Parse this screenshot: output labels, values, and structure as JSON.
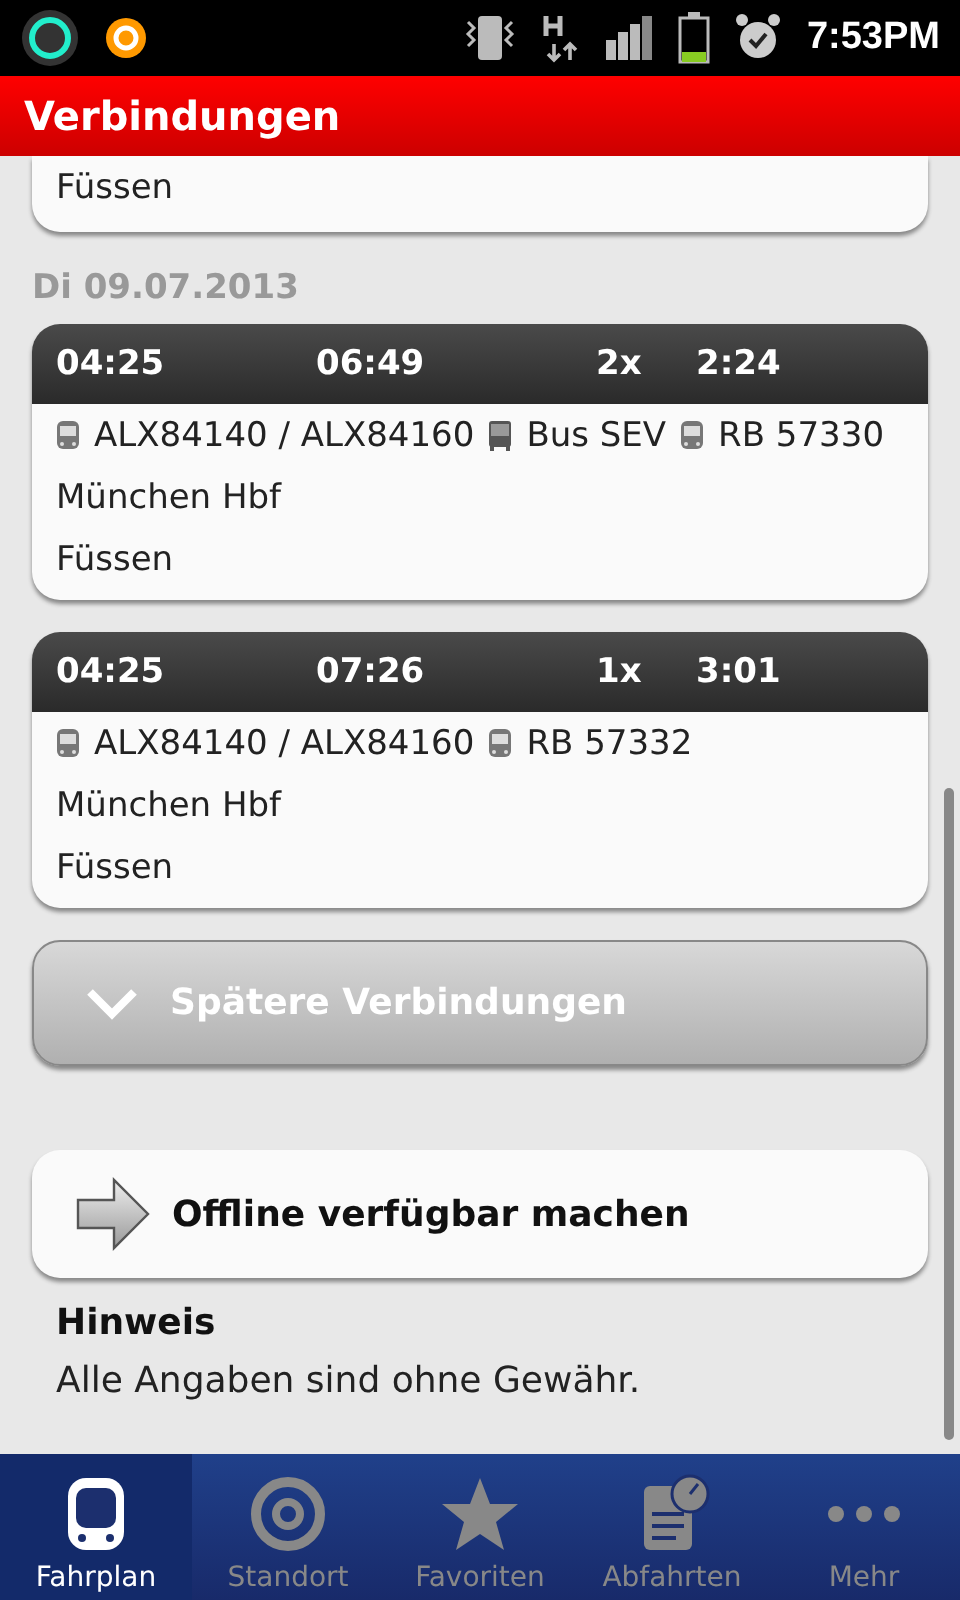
{
  "status_bar": {
    "time": "7:53PM"
  },
  "title": "Verbindungen",
  "partial_card": {
    "destination": "Füssen"
  },
  "date": "Di 09.07.2013",
  "connections": [
    {
      "departure": "04:25",
      "arrival": "06:49",
      "changes": "2x",
      "duration": "2:24",
      "legs": [
        {
          "kind": "train",
          "name": "ALX84140 / ALX84160"
        },
        {
          "kind": "bus",
          "name": "Bus SEV"
        },
        {
          "kind": "train",
          "name": "RB 57330"
        }
      ],
      "origin": "München Hbf",
      "destination": "Füssen"
    },
    {
      "departure": "04:25",
      "arrival": "07:26",
      "changes": "1x",
      "duration": "3:01",
      "legs": [
        {
          "kind": "train",
          "name": "ALX84140 / ALX84160"
        },
        {
          "kind": "train",
          "name": "RB 57332"
        }
      ],
      "origin": "München Hbf",
      "destination": "Füssen"
    }
  ],
  "later_button": "Spätere Verbindungen",
  "offline_button": "Offline verfügbar machen",
  "notice": {
    "heading": "Hinweis",
    "text": "Alle Angaben sind ohne Gewähr."
  },
  "nav": [
    {
      "kind": "train",
      "label": "Fahrplan",
      "selected": true
    },
    {
      "kind": "location",
      "label": "Standort",
      "selected": false
    },
    {
      "kind": "star",
      "label": "Favoriten",
      "selected": false
    },
    {
      "kind": "departures",
      "label": "Abfahrten",
      "selected": false
    },
    {
      "kind": "more",
      "label": "Mehr",
      "selected": false
    }
  ]
}
